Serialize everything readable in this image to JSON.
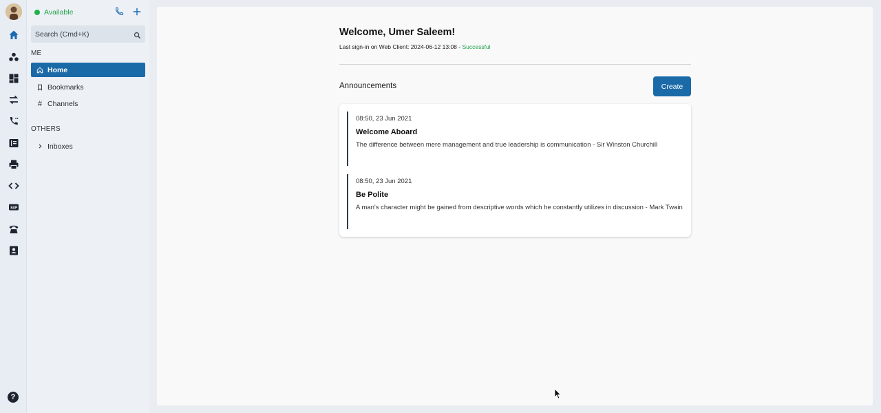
{
  "sidebar": {
    "status": "Available",
    "search_placeholder": "Search (Cmd+K)",
    "section_me": "ME",
    "section_others": "OTHERS",
    "items": [
      {
        "label": "Home"
      },
      {
        "label": "Bookmarks"
      },
      {
        "label": "Channels"
      }
    ],
    "others_items": [
      {
        "label": "Inboxes"
      }
    ]
  },
  "main": {
    "welcome": "Welcome, Umer Saleem!",
    "signin_prefix": "Last sign-in on Web Client: 2024-06-12 13:08 - ",
    "signin_status": "Successful",
    "announcements_title": "Announcements",
    "create_label": "Create",
    "announcements": [
      {
        "time": "08:50, 23 Jun 2021",
        "title": "Welcome Aboard",
        "body": "The difference between mere management and true leadership is communication - Sir Winston Churchill"
      },
      {
        "time": "08:50, 23 Jun 2021",
        "title": "Be Polite",
        "body": "A man's character might be gained from descriptive words which he constantly utilizes in discussion - Mark Twain"
      }
    ]
  },
  "colors": {
    "accent": "#1b6aa8",
    "success": "#22a34a"
  }
}
